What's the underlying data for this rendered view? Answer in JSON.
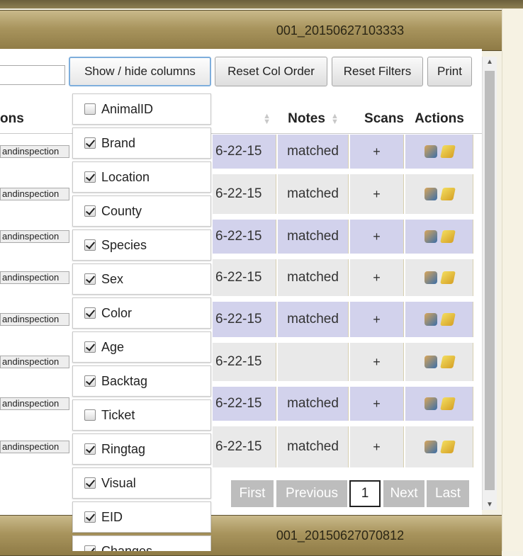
{
  "records": [
    {
      "id": "001_20150627103333"
    },
    {
      "id": "001_20150627070812"
    }
  ],
  "toolbar": {
    "show_hide": "Show / hide columns",
    "reset_col": "Reset Col Order",
    "reset_filters": "Reset Filters",
    "print": "Print"
  },
  "table": {
    "headers": {
      "inspections_partial": "ons",
      "notes": "Notes",
      "scans": "Scans",
      "actions": "Actions"
    },
    "rows": [
      {
        "tag": "andinspection",
        "date": "6-22-15",
        "notes": "matched",
        "scans": "+"
      },
      {
        "tag": "andinspection",
        "date": "6-22-15",
        "notes": "matched",
        "scans": "+"
      },
      {
        "tag": "andinspection",
        "date": "6-22-15",
        "notes": "matched",
        "scans": "+"
      },
      {
        "tag": "andinspection",
        "date": "6-22-15",
        "notes": "matched",
        "scans": "+"
      },
      {
        "tag": "andinspection",
        "date": "6-22-15",
        "notes": "matched",
        "scans": "+"
      },
      {
        "tag": "andinspection",
        "date": "6-22-15",
        "notes": "",
        "scans": "+"
      },
      {
        "tag": "andinspection",
        "date": "6-22-15",
        "notes": "matched",
        "scans": "+"
      },
      {
        "tag": "andinspection",
        "date": "6-22-15",
        "notes": "matched",
        "scans": "+"
      }
    ]
  },
  "pagination": {
    "first": "First",
    "previous": "Previous",
    "current": "1",
    "next": "Next",
    "last": "Last"
  },
  "columns_menu": [
    {
      "label": "AnimalID",
      "checked": false
    },
    {
      "label": "Brand",
      "checked": true
    },
    {
      "label": "Location",
      "checked": true
    },
    {
      "label": "County",
      "checked": true
    },
    {
      "label": "Species",
      "checked": true
    },
    {
      "label": "Sex",
      "checked": true
    },
    {
      "label": "Color",
      "checked": true
    },
    {
      "label": "Age",
      "checked": true
    },
    {
      "label": "Backtag",
      "checked": true
    },
    {
      "label": "Ticket",
      "checked": false
    },
    {
      "label": "Ringtag",
      "checked": true
    },
    {
      "label": "Visual",
      "checked": true
    },
    {
      "label": "EID",
      "checked": true
    },
    {
      "label": "Changes",
      "checked": true
    }
  ]
}
